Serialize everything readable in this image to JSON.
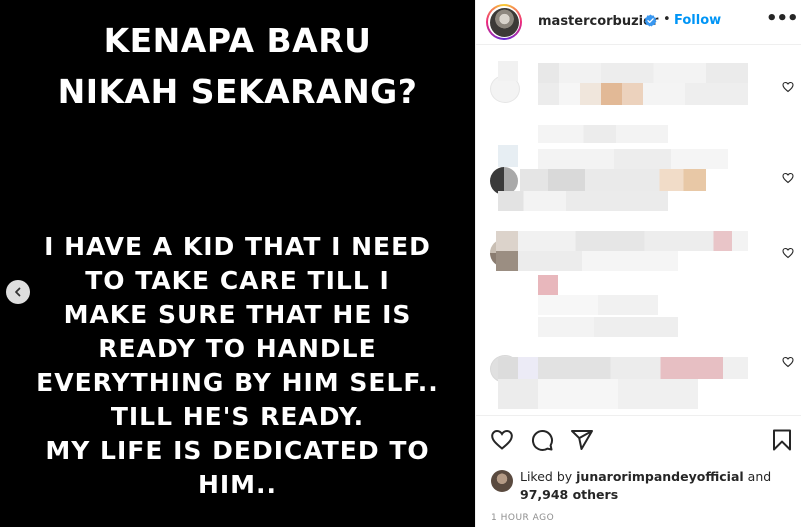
{
  "post": {
    "title_lines": [
      "KENAPA BARU",
      "NIKAH SEKARANG?"
    ],
    "body_lines": [
      "I HAVE A KID THAT I NEED",
      "TO TAKE CARE TILL I",
      "MAKE SURE THAT HE IS",
      "READY TO HANDLE",
      "EVERYTHING BY HIM SELF..",
      "TILL HE'S READY.",
      "MY LIFE IS DEDICATED TO",
      "HIM.."
    ],
    "prev_icon": "chevron-left-icon"
  },
  "header": {
    "username": "mastercorbuzier",
    "separator": "•",
    "follow_label": "Follow",
    "verified_icon": "verified-badge-icon",
    "more_icon": "more-options-icon",
    "more_label": "•••"
  },
  "actions": {
    "icons": [
      "heart-icon",
      "comment-icon",
      "share-icon",
      "bookmark-icon"
    ]
  },
  "likes": {
    "prefix": "Liked by ",
    "user": "junarorimpandeyofficial",
    "conjunction": " and",
    "count_text": "97,948 others"
  },
  "timestamp": "1 HOUR AGO",
  "colors": {
    "accent": "#0095f6",
    "text": "#262626",
    "muted": "#8e8e8e",
    "post_bg": "#000000"
  }
}
